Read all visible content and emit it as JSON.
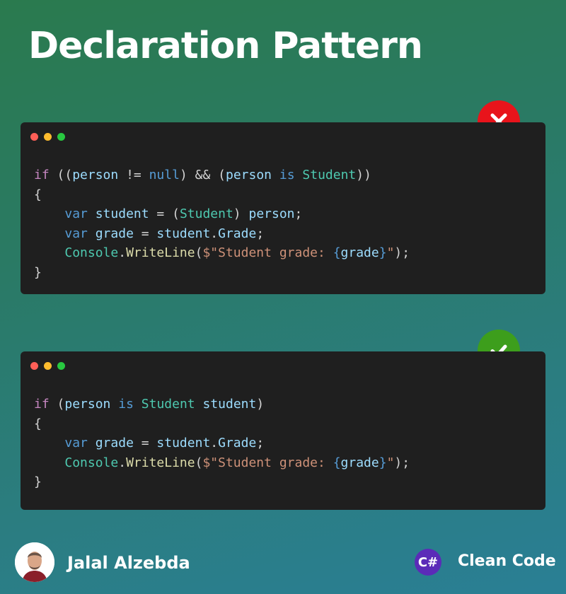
{
  "title": "Declaration Pattern",
  "bad_example": {
    "status_icon": "close-icon",
    "lines": [
      [
        [
          "kw",
          "if"
        ],
        [
          "pl",
          " (("
        ],
        [
          "id",
          "person"
        ],
        [
          "pl",
          " != "
        ],
        [
          "kb",
          "null"
        ],
        [
          "pl",
          ") && ("
        ],
        [
          "id",
          "person"
        ],
        [
          "pl",
          " "
        ],
        [
          "kb",
          "is"
        ],
        [
          "pl",
          " "
        ],
        [
          "ty",
          "Student"
        ],
        [
          "pl",
          "))"
        ]
      ],
      [
        [
          "pl",
          "{"
        ]
      ],
      [
        [
          "pl",
          "    "
        ],
        [
          "kb",
          "var"
        ],
        [
          "pl",
          " "
        ],
        [
          "id",
          "student"
        ],
        [
          "pl",
          " = ("
        ],
        [
          "ty",
          "Student"
        ],
        [
          "pl",
          ") "
        ],
        [
          "id",
          "person"
        ],
        [
          "pl",
          ";"
        ]
      ],
      [
        [
          "pl",
          "    "
        ],
        [
          "kb",
          "var"
        ],
        [
          "pl",
          " "
        ],
        [
          "id",
          "grade"
        ],
        [
          "pl",
          " = "
        ],
        [
          "id",
          "student"
        ],
        [
          "pl",
          "."
        ],
        [
          "id",
          "Grade"
        ],
        [
          "pl",
          ";"
        ]
      ],
      [
        [
          "pl",
          "    "
        ],
        [
          "ty",
          "Console"
        ],
        [
          "pl",
          "."
        ],
        [
          "fn",
          "WriteLine"
        ],
        [
          "pl",
          "("
        ],
        [
          "st",
          "$\"Student grade: "
        ],
        [
          "kb",
          "{"
        ],
        [
          "id",
          "grade"
        ],
        [
          "kb",
          "}"
        ],
        [
          "st",
          "\""
        ],
        [
          "pl",
          ");"
        ]
      ],
      [
        [
          "pl",
          "}"
        ]
      ]
    ]
  },
  "good_example": {
    "status_icon": "check-icon",
    "lines": [
      [
        [
          "kw",
          "if"
        ],
        [
          "pl",
          " ("
        ],
        [
          "id",
          "person"
        ],
        [
          "pl",
          " "
        ],
        [
          "kb",
          "is"
        ],
        [
          "pl",
          " "
        ],
        [
          "ty",
          "Student"
        ],
        [
          "pl",
          " "
        ],
        [
          "id",
          "student"
        ],
        [
          "pl",
          ")"
        ]
      ],
      [
        [
          "pl",
          "{"
        ]
      ],
      [
        [
          "pl",
          "    "
        ],
        [
          "kb",
          "var"
        ],
        [
          "pl",
          " "
        ],
        [
          "id",
          "grade"
        ],
        [
          "pl",
          " = "
        ],
        [
          "id",
          "student"
        ],
        [
          "pl",
          "."
        ],
        [
          "id",
          "Grade"
        ],
        [
          "pl",
          ";"
        ]
      ],
      [
        [
          "pl",
          "    "
        ],
        [
          "ty",
          "Console"
        ],
        [
          "pl",
          "."
        ],
        [
          "fn",
          "WriteLine"
        ],
        [
          "pl",
          "("
        ],
        [
          "st",
          "$\"Student grade: "
        ],
        [
          "kb",
          "{"
        ],
        [
          "id",
          "grade"
        ],
        [
          "kb",
          "}"
        ],
        [
          "st",
          "\""
        ],
        [
          "pl",
          ");"
        ]
      ],
      [
        [
          "pl",
          "}"
        ]
      ]
    ]
  },
  "footer": {
    "author": "Jalal Alzebda",
    "logo_text": "C#",
    "brand": "Clean Code"
  },
  "colors": {
    "keyword": "#c586c0",
    "builtin": "#569cd6",
    "type": "#4ec9b0",
    "identifier": "#9cdcfe",
    "function": "#dcdcaa",
    "string": "#ce9178",
    "bad": "#e8141b",
    "good": "#3d9e1c"
  }
}
